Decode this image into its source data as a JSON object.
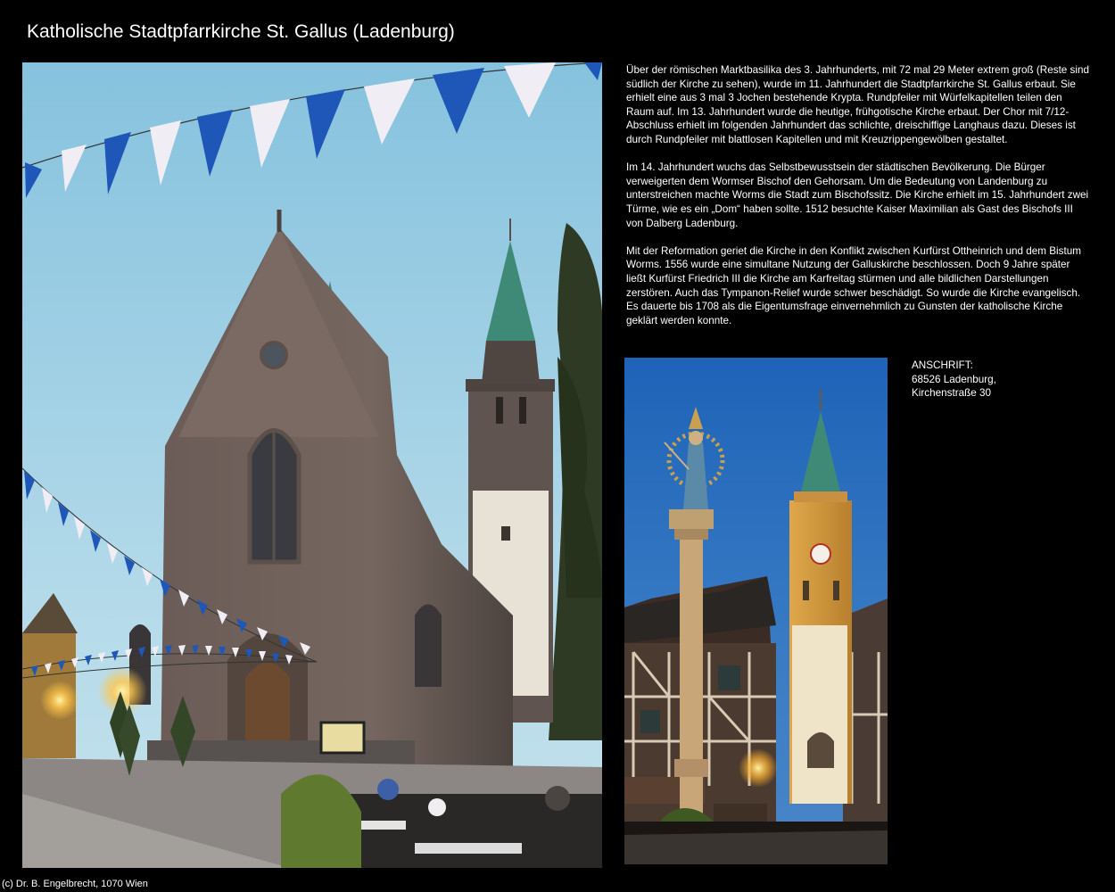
{
  "page": {
    "title": "Katholische Stadtpfarrkirche St. Gallus (Ladenburg)",
    "footer": "(c) Dr. B. Engelbrecht, 1070 Wien"
  },
  "description": {
    "paragraphs": [
      "Über der römischen Marktbasilika des 3. Jahrhunderts, mit 72 mal 29 Meter extrem groß (Reste sind südlich der Kirche zu sehen),  wurde im 11. Jahrhundert die Stadtpfarrkirche St. Gallus erbaut. Sie erhielt eine aus 3 mal 3 Jochen bestehende Krypta. Rundpfeiler mit Würfelkapitellen teilen den Raum auf. Im 13. Jahrhundert wurde die heutige, frühgotische Kirche erbaut. Der Chor mit 7/12-Abschluss erhielt im folgenden Jahrhundert das schlichte, dreischiffige Langhaus dazu. Dieses ist durch Rundpfeiler mit blattlosen Kapitellen und mit Kreuzrippengewölben gestaltet.",
      "Im 14. Jahrhundert wuchs das Selbstbewusstsein der städtischen Bevölkerung. Die Bürger verweigerten dem Wormser Bischof den Gehorsam. Um die Bedeutung von Landenburg zu unterstreichen machte Worms die Stadt zum Bischofssitz. Die Kirche erhielt im 15. Jahrhundert zwei Türme, wie es ein „Dom“ haben sollte. 1512 besuchte Kaiser Maximilian als Gast des Bischofs III von Dalberg Ladenburg.",
      "Mit der Reformation geriet die Kirche in den Konflikt zwischen Kurfürst Ottheinrich und dem Bistum Worms. 1556 wurde eine simultane Nutzung der Galluskirche beschlossen. Doch 9 Jahre später ließt Kurfürst Friedrich III die Kirche am Karfreitag stürmen und alle bildlichen Darstellungen zerstören. Auch das Tympanon-Relief wurde schwer beschädigt. So wurde die Kirche evangelisch. Es dauerte bis 1708 als die Eigentumsfrage einvernehmlich zu Gunsten der katholische Kirche geklärt werden konnte."
    ]
  },
  "address": {
    "label": "ANSCHRIFT:",
    "line1": "68526 Ladenburg,",
    "line2": "Kirchenstraße 30"
  },
  "colors": {
    "background": "#000000",
    "text": "#ffffff",
    "sky_top": "#8fc6e0",
    "sky_bottom": "#b9dcea",
    "stone": "#6e5f59",
    "copper_spire": "#3f8a77",
    "flag_blue": "#1e57b8",
    "flag_white": "#f0eef4",
    "lamp_glow": "#ffc64a"
  },
  "icons": {
    "main_photo": "church-photo",
    "second_photo": "column-tower-photo"
  }
}
